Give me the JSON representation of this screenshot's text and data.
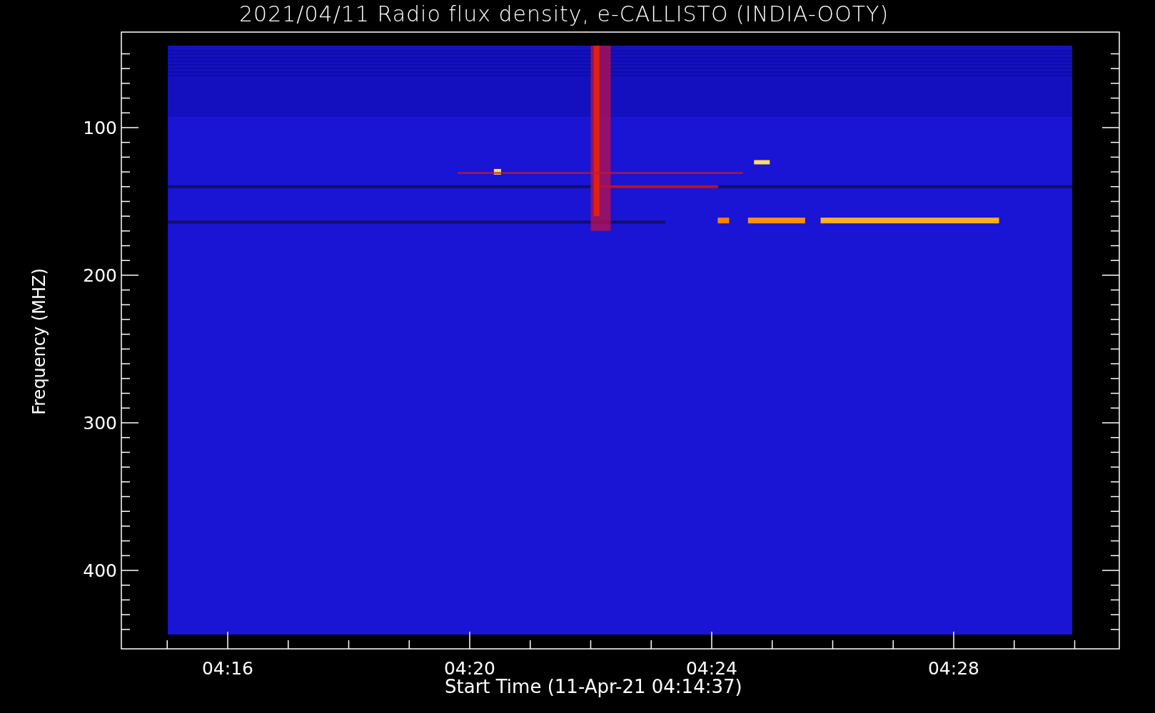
{
  "title": "2021/04/11  Radio flux density, e-CALLISTO (INDIA-OOTY)",
  "y_axis": {
    "label": "Frequency (MHZ)",
    "ticks": [
      "100",
      "200",
      "300",
      "400"
    ]
  },
  "x_axis": {
    "label": "Start Time (11-Apr-21 04:14:37)",
    "ticks": [
      "04:16",
      "04:20",
      "04:24",
      "04:28"
    ]
  }
}
